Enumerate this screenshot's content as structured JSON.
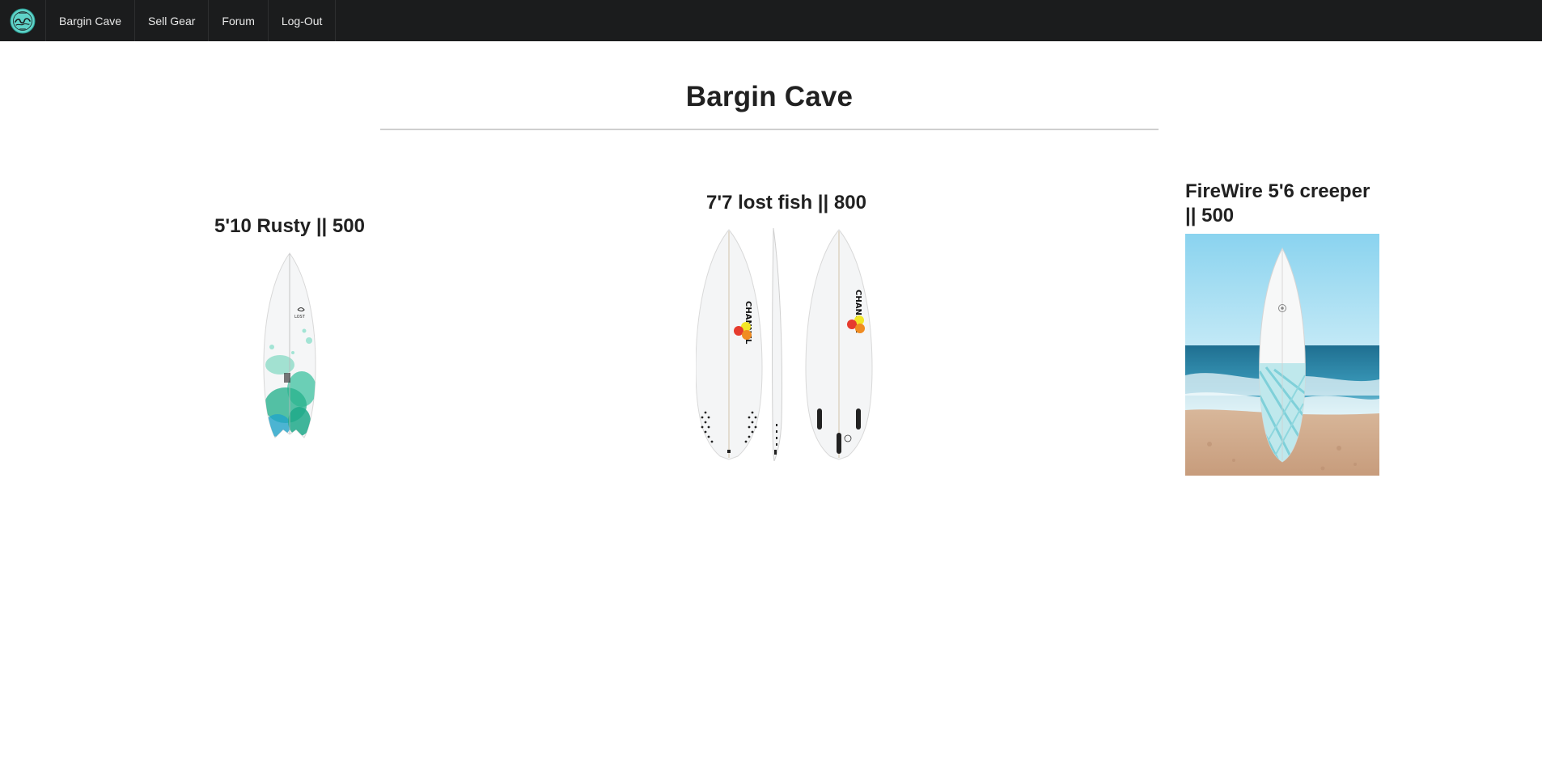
{
  "nav": {
    "logo_icon": "wave-logo-icon",
    "items": [
      {
        "label": "Bargin Cave"
      },
      {
        "label": "Sell Gear"
      },
      {
        "label": "Forum"
      },
      {
        "label": "Log-Out"
      }
    ]
  },
  "page": {
    "title": "Bargin Cave"
  },
  "listings": [
    {
      "title": "5'10 Rusty || 500",
      "image_icon": "surfboard-fish-image"
    },
    {
      "title": "7'7 lost fish || 800",
      "image_icon": "surfboard-three-views-image"
    },
    {
      "title": "FireWire 5'6 creeper || 500",
      "image_icon": "surfboard-beach-photo"
    }
  ],
  "colors": {
    "navbar": "#1b1c1d",
    "nav_text": "#e9e9e9",
    "title": "#212121",
    "divider": "#cfcfcf",
    "logo_teal": "#5fd3c8"
  }
}
